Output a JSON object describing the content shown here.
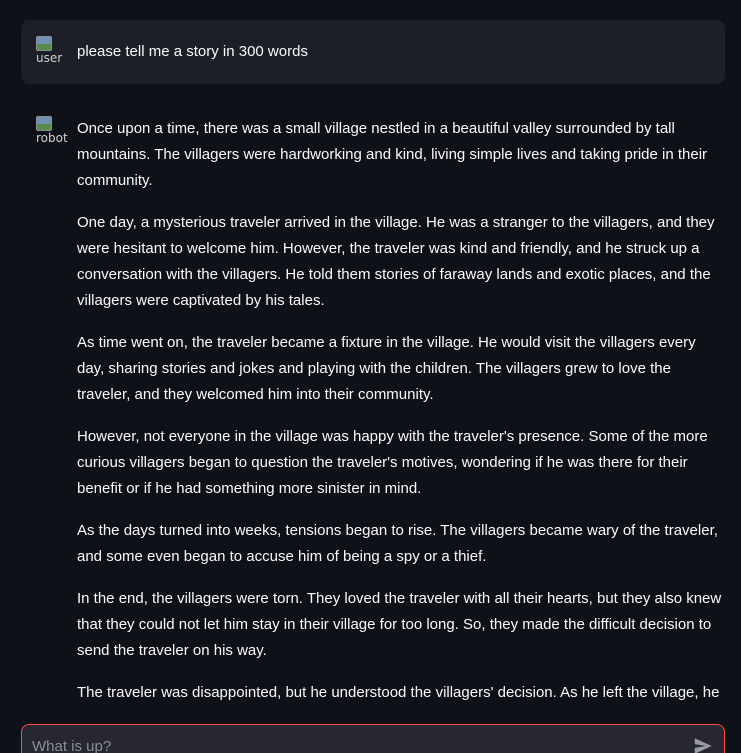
{
  "messages": {
    "user": {
      "avatar_alt": "user",
      "text": "please tell me a story in 300 words"
    },
    "assistant": {
      "avatar_alt": "robot",
      "paragraphs": [
        "Once upon a time, there was a small village nestled in a beautiful valley surrounded by tall mountains. The villagers were hardworking and kind, living simple lives and taking pride in their community.",
        "One day, a mysterious traveler arrived in the village. He was a stranger to the villagers, and they were hesitant to welcome him. However, the traveler was kind and friendly, and he struck up a conversation with the villagers. He told them stories of faraway lands and exotic places, and the villagers were captivated by his tales.",
        "As time went on, the traveler became a fixture in the village. He would visit the villagers every day, sharing stories and jokes and playing with the children. The villagers grew to love the traveler, and they welcomed him into their community.",
        "However, not everyone in the village was happy with the traveler's presence. Some of the more curious villagers began to question the traveler's motives, wondering if he was there for their benefit or if he had something more sinister in mind.",
        "As the days turned into weeks, tensions began to rise. The villagers became wary of the traveler, and some even began to accuse him of being a spy or a thief.",
        "In the end, the villagers were torn. They loved the traveler with all their hearts, but they also knew that they could not let him stay in their village for too long. So, they made the difficult decision to send the traveler on his way.",
        "The traveler was disappointed, but he understood the villagers' decision. As he left the village, he reflected on the kindness and hospitality he had received from the villagers, and he knew that he"
      ]
    }
  },
  "chat_input": {
    "placeholder": "What is up?",
    "send_icon": "send-icon"
  },
  "colors": {
    "background": "#0e1117",
    "user_bubble": "#1c1f27",
    "input_border_focus": "#ff4b4b",
    "input_background": "#262730"
  }
}
